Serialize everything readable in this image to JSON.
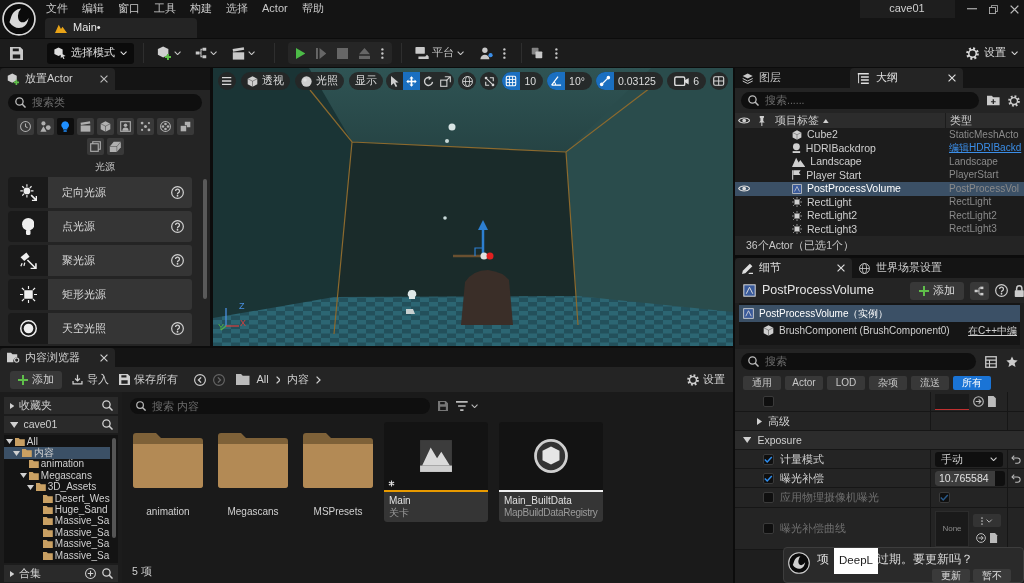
{
  "title_bar": {
    "menu": [
      "文件",
      "编辑",
      "窗口",
      "工具",
      "构建",
      "选择",
      "Actor",
      "帮助"
    ],
    "tabs": [
      {
        "label": "Main•",
        "selected": true
      }
    ],
    "project": "cave01"
  },
  "main_toolbar": {
    "mode": "选择模式",
    "play_controls": [
      {
        "kind": "play",
        "disabled": false
      },
      {
        "kind": "step",
        "disabled": true
      },
      {
        "kind": "stop",
        "disabled": true
      },
      {
        "kind": "eject",
        "disabled": true
      }
    ],
    "platforms": "平台",
    "settings": "设置"
  },
  "place_actors": {
    "tab": "放置Actor",
    "search": {
      "placeholder": "搜索类"
    },
    "categories": [
      {
        "kind": "clock",
        "selected": false
      },
      {
        "kind": "shapes",
        "selected": false
      },
      {
        "kind": "bulb",
        "selected": true
      },
      {
        "kind": "clapper",
        "selected": false
      },
      {
        "kind": "cube",
        "selected": false
      },
      {
        "kind": "portrait",
        "selected": false
      },
      {
        "kind": "particles",
        "selected": false
      },
      {
        "kind": "reel",
        "selected": false
      },
      {
        "kind": "boxes",
        "selected": false
      },
      {
        "kind": "frame",
        "selected": false
      },
      {
        "kind": "block",
        "selected": false
      }
    ],
    "category_title": "光源",
    "items": [
      {
        "kind": "directional",
        "label": "定向光源",
        "help": true
      },
      {
        "kind": "point",
        "label": "点光源",
        "help": true
      },
      {
        "kind": "spot",
        "label": "聚光源",
        "help": true
      },
      {
        "kind": "rect",
        "label": "矩形光源",
        "help": false
      },
      {
        "kind": "sky",
        "label": "天空光照",
        "help": true
      }
    ]
  },
  "viewport": {
    "view_mode": "透视",
    "lighting": "光照",
    "show": "显示",
    "transform_tools": [
      {
        "kind": "select",
        "selected": false
      },
      {
        "kind": "move",
        "selected": true
      },
      {
        "kind": "rotate",
        "selected": false
      },
      {
        "kind": "scale",
        "selected": false
      }
    ],
    "snaps": [
      {
        "kind": "grid",
        "value": "10",
        "on": true
      },
      {
        "kind": "angle",
        "value": "10°",
        "on": true
      },
      {
        "kind": "scale",
        "value": "0.03125",
        "on": true
      }
    ],
    "camera_speed": "6",
    "axes": [
      "Z",
      "Y",
      "X"
    ]
  },
  "outliner": {
    "tabs": [
      {
        "kind": "layers",
        "label": "图层",
        "selected": false
      },
      {
        "kind": "outline",
        "label": "大纲",
        "selected": true
      }
    ],
    "search": {
      "placeholder": "搜索......"
    },
    "columns": [
      "项目标签",
      "类型"
    ],
    "rows": [
      {
        "kind": "mesh",
        "name": "Cube2",
        "type": "StaticMeshActo",
        "type_link": false,
        "selected": false
      },
      {
        "kind": "backdrop",
        "name": "HDRIBackdrop",
        "type": "编辑HDRIBackd",
        "type_link": true,
        "selected": false
      },
      {
        "kind": "landscape",
        "name": "Landscape",
        "type": "Landscape",
        "type_link": false,
        "selected": false
      },
      {
        "kind": "player_start",
        "name": "Player Start",
        "type": "PlayerStart",
        "type_link": false,
        "selected": false
      },
      {
        "kind": "volume",
        "name": "PostProcessVolume",
        "type": "PostProcessVol",
        "type_link": false,
        "selected": true
      },
      {
        "kind": "rect_light",
        "name": "RectLight",
        "type": "RectLight",
        "type_link": false,
        "selected": false
      },
      {
        "kind": "rect_light",
        "name": "RectLight2",
        "type": "RectLight2",
        "type_link": false,
        "selected": false
      },
      {
        "kind": "rect_light",
        "name": "RectLight3",
        "type": "RectLight3",
        "type_link": false,
        "selected": false
      }
    ],
    "footer": "36个Actor（已选1个）"
  },
  "details": {
    "tabs": [
      {
        "kind": "details",
        "label": "细节",
        "selected": true
      },
      {
        "kind": "world",
        "label": "世界场景设置",
        "selected": false
      }
    ],
    "object": "PostProcessVolume",
    "add_button": "添加",
    "components": [
      {
        "label": "PostProcessVolume（实例）",
        "selected": true
      },
      {
        "label": "BrushComponent (BrushComponent0)",
        "selected": false,
        "link": "在C++中编"
      }
    ],
    "search": {
      "placeholder": "搜索"
    },
    "filters": [
      {
        "label": "通用",
        "selected": false
      },
      {
        "label": "Actor",
        "selected": false
      },
      {
        "label": "LOD",
        "selected": false
      },
      {
        "label": "杂项",
        "selected": false
      },
      {
        "label": "流送",
        "selected": false
      },
      {
        "label": "所有",
        "selected": true
      }
    ],
    "properties": [
      {
        "kind": "asset",
        "checked": false
      },
      {
        "kind": "group",
        "label": "高级",
        "expanded": false
      },
      {
        "kind": "section",
        "label": "Exposure",
        "expanded": true
      },
      {
        "kind": "dropdown",
        "label": "计量模式",
        "checked": true,
        "value": "手动"
      },
      {
        "kind": "number",
        "label": "曝光补偿",
        "checked": true,
        "value": "10.765584",
        "level": 0.86
      },
      {
        "kind": "checkbox",
        "label": "应用物理摄像机曝光",
        "checked": false,
        "value_checked": true
      },
      {
        "kind": "curve",
        "label": "曝光补偿曲线",
        "checked": false,
        "value": "None"
      }
    ]
  },
  "notification": {
    "message_start": "项",
    "message_end": "过期。要更新吗？",
    "buttons": [
      "更新",
      "暂不"
    ]
  },
  "deepl_popup": {
    "label": "DeepL"
  },
  "content_browser": {
    "tab": "内容浏览器",
    "toolbar": {
      "add": "添加",
      "import": "导入",
      "save_all": "保存所有",
      "path": [
        "All",
        "内容"
      ],
      "settings": "设置"
    },
    "favorites": {
      "label": "收藏夹",
      "expanded": false
    },
    "project": {
      "label": "cave01",
      "expanded": true
    },
    "tree": [
      {
        "label": "All",
        "expanded": true,
        "selected": false,
        "children": [
          {
            "label": "内容",
            "expanded": true,
            "selected": true,
            "children": [
              {
                "label": "animation",
                "selected": false
              },
              {
                "label": "Megascans",
                "expanded": true,
                "selected": false,
                "children": [
                  {
                    "label": "3D_Assets",
                    "expanded": true,
                    "selected": false,
                    "children": [
                      {
                        "label": "Desert_Wes",
                        "selected": false
                      },
                      {
                        "label": "Huge_Sand",
                        "selected": false
                      },
                      {
                        "label": "Massive_Sa",
                        "selected": false
                      },
                      {
                        "label": "Massive_Sa",
                        "selected": false
                      },
                      {
                        "label": "Massive_Sa",
                        "selected": false
                      },
                      {
                        "label": "Massive_Sa",
                        "selected": false
                      }
                    ]
                  }
                ]
              }
            ]
          }
        ]
      }
    ],
    "collections": {
      "label": "合集",
      "expanded": false
    },
    "search": {
      "placeholder": "搜索 内容"
    },
    "assets": [
      {
        "kind": "folder",
        "name": "animation"
      },
      {
        "kind": "folder",
        "name": "Megascans"
      },
      {
        "kind": "folder",
        "name": "MSPresets"
      },
      {
        "kind": "level",
        "name": "Main",
        "type": "关卡",
        "color": "#e89a00",
        "modified": true
      },
      {
        "kind": "data",
        "name": "Main_BuiltData",
        "type": "MapBuildDataRegistry",
        "color": "#f0f0f0",
        "modified": false
      }
    ],
    "count": "5 项"
  }
}
